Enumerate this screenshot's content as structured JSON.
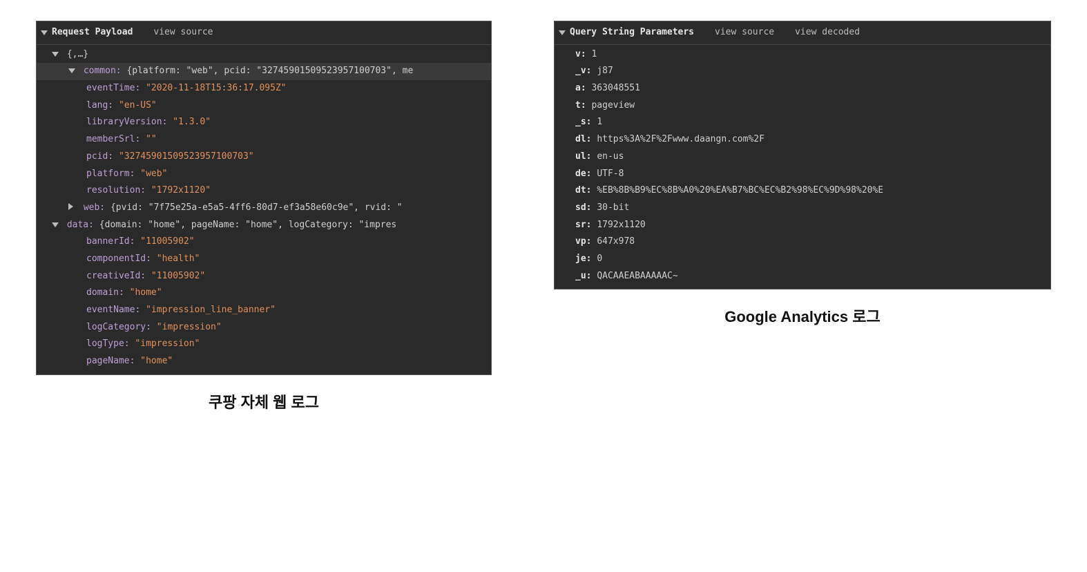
{
  "left": {
    "header": {
      "title": "Request Payload",
      "viewSource": "view source"
    },
    "rootBrace": "{,…}",
    "common": {
      "label": "common:",
      "preview": "{platform: \"web\", pcid: \"32745901509523957100703\", me",
      "fields": {
        "eventTime": {
          "k": "eventTime:",
          "v": "\"2020-11-18T15:36:17.095Z\""
        },
        "lang": {
          "k": "lang:",
          "v": "\"en-US\""
        },
        "libraryVersion": {
          "k": "libraryVersion:",
          "v": "\"1.3.0\""
        },
        "memberSrl": {
          "k": "memberSrl:",
          "v": "\"\""
        },
        "pcid": {
          "k": "pcid:",
          "v": "\"32745901509523957100703\""
        },
        "platform": {
          "k": "platform:",
          "v": "\"web\""
        },
        "resolution": {
          "k": "resolution:",
          "v": "\"1792x1120\""
        }
      },
      "web": {
        "k": "web:",
        "preview": "{pvid: \"7f75e25a-e5a5-4ff6-80d7-ef3a58e60c9e\", rvid: \""
      }
    },
    "data": {
      "label": "data:",
      "preview": "{domain: \"home\", pageName: \"home\", logCategory: \"impres",
      "fields": {
        "bannerId": {
          "k": "bannerId:",
          "v": "\"11005902\""
        },
        "componentId": {
          "k": "componentId:",
          "v": "\"health\""
        },
        "creativeId": {
          "k": "creativeId:",
          "v": "\"11005902\""
        },
        "domain": {
          "k": "domain:",
          "v": "\"home\""
        },
        "eventName": {
          "k": "eventName:",
          "v": "\"impression_line_banner\""
        },
        "logCategory": {
          "k": "logCategory:",
          "v": "\"impression\""
        },
        "logType": {
          "k": "logType:",
          "v": "\"impression\""
        },
        "pageName": {
          "k": "pageName:",
          "v": "\"home\""
        }
      }
    },
    "caption": "쿠팡 자체 웹 로그"
  },
  "right": {
    "header": {
      "title": "Query String Parameters",
      "viewSource": "view source",
      "viewDecoded": "view decoded"
    },
    "params": [
      {
        "k": "v:",
        "v": "1"
      },
      {
        "k": "_v:",
        "v": "j87"
      },
      {
        "k": "a:",
        "v": "363048551"
      },
      {
        "k": "t:",
        "v": "pageview"
      },
      {
        "k": "_s:",
        "v": "1"
      },
      {
        "k": "dl:",
        "v": "https%3A%2F%2Fwww.daangn.com%2F"
      },
      {
        "k": "ul:",
        "v": "en-us"
      },
      {
        "k": "de:",
        "v": "UTF-8"
      },
      {
        "k": "dt:",
        "v": "%EB%8B%B9%EC%8B%A0%20%EA%B7%BC%EC%B2%98%EC%9D%98%20%E"
      },
      {
        "k": "sd:",
        "v": "30-bit"
      },
      {
        "k": "sr:",
        "v": "1792x1120"
      },
      {
        "k": "vp:",
        "v": "647x978"
      },
      {
        "k": "je:",
        "v": "0"
      },
      {
        "k": "_u:",
        "v": "QACAAEABAAAAAC~"
      }
    ],
    "caption": "Google Analytics 로그"
  }
}
